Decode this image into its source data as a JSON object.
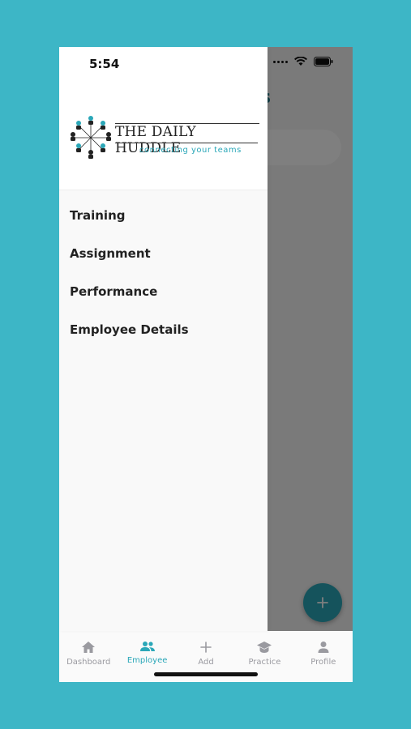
{
  "status_bar": {
    "time": "5:54"
  },
  "drawer": {
    "brand": {
      "title": "THE DAILY HUDDLE",
      "tagline": "connecting your teams"
    },
    "items": [
      {
        "label": "Training"
      },
      {
        "label": "Assignment"
      },
      {
        "label": "Performance"
      },
      {
        "label": "Employee Details"
      }
    ]
  },
  "underlying": {
    "title_fragment": "s"
  },
  "bottom_nav": {
    "items": [
      {
        "label": "Dashboard",
        "icon": "home-icon",
        "active": false
      },
      {
        "label": "Employee",
        "icon": "people-icon",
        "active": true
      },
      {
        "label": "Add",
        "icon": "plus-icon",
        "active": false
      },
      {
        "label": "Practice",
        "icon": "graduation-cap-icon",
        "active": false
      },
      {
        "label": "Profile",
        "icon": "person-icon",
        "active": false
      }
    ]
  },
  "colors": {
    "accent": "#2aa7b8",
    "background": "#3db6c6",
    "inactive": "#9a9aa0"
  }
}
